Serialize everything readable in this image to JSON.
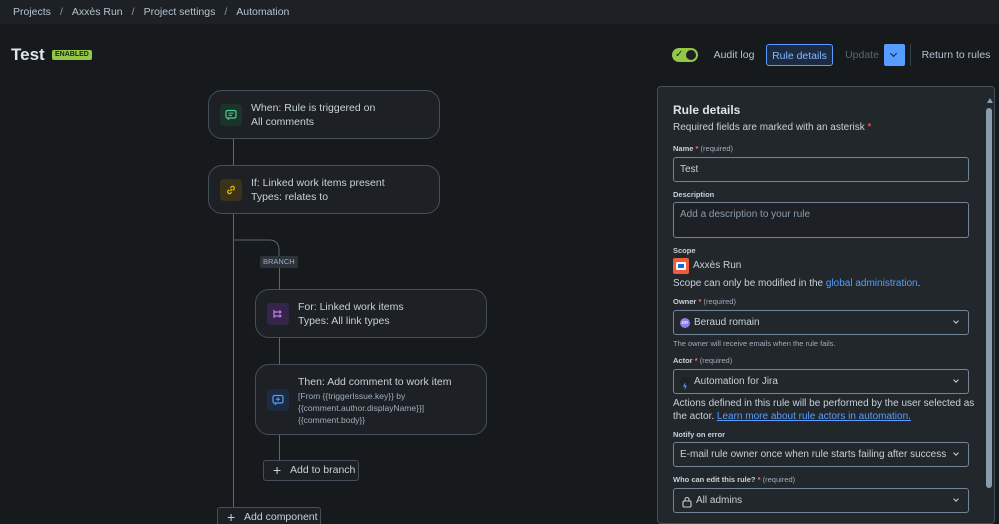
{
  "breadcrumb": [
    "Projects",
    "Axxès Run",
    "Project settings",
    "Automation"
  ],
  "header": {
    "title": "Test",
    "status_badge": "ENABLED",
    "audit_log": "Audit log",
    "rule_details": "Rule details",
    "update": "Update",
    "return": "Return to rules",
    "toggle_on": true
  },
  "flow": {
    "trigger": {
      "line1": "When: Rule is triggered on",
      "line2": "All comments"
    },
    "condition": {
      "line1": "If: Linked work items present",
      "line2": "Types: relates to"
    },
    "branch_label": "BRANCH",
    "branch": {
      "line1": "For: Linked work items",
      "line2": "Types: All link types"
    },
    "action": {
      "line1": "Then: Add comment to work item",
      "line2": "[From {{triggerIssue.key}} by",
      "line3": "{{comment.author.displayName}}]",
      "line4": "{{comment.body}}"
    },
    "add_to_branch": "Add to branch",
    "add_component": "Add component"
  },
  "panel": {
    "title": "Rule details",
    "required_note": "Required fields are marked with an asterisk",
    "name_label": "Name",
    "required_text": "(required)",
    "name_value": "Test",
    "description_label": "Description",
    "description_placeholder": "Add a description to your rule",
    "scope_label": "Scope",
    "scope_value": "Axxès Run",
    "scope_note_pre": "Scope can only be modified in the ",
    "scope_note_link": "global administration",
    "scope_note_post": ".",
    "owner_label": "Owner",
    "owner_value": "Beraud romain",
    "owner_initials": "BR",
    "owner_helper": "The owner will receive emails when the rule fails.",
    "actor_label": "Actor",
    "actor_value": "Automation for Jira",
    "actor_note_line1": "Actions defined in this rule will be performed by the user selected as",
    "actor_note_pre": "the actor. ",
    "actor_note_link": "Learn more about rule actors in automation.",
    "notify_label": "Notify on error",
    "notify_value": "E-mail rule owner once when rule starts failing after success",
    "who_label": "Who can edit this rule?",
    "who_value": "All admins"
  },
  "colors": {
    "accent": "#579dff",
    "enabled": "#94c748",
    "required": "#f87168"
  }
}
